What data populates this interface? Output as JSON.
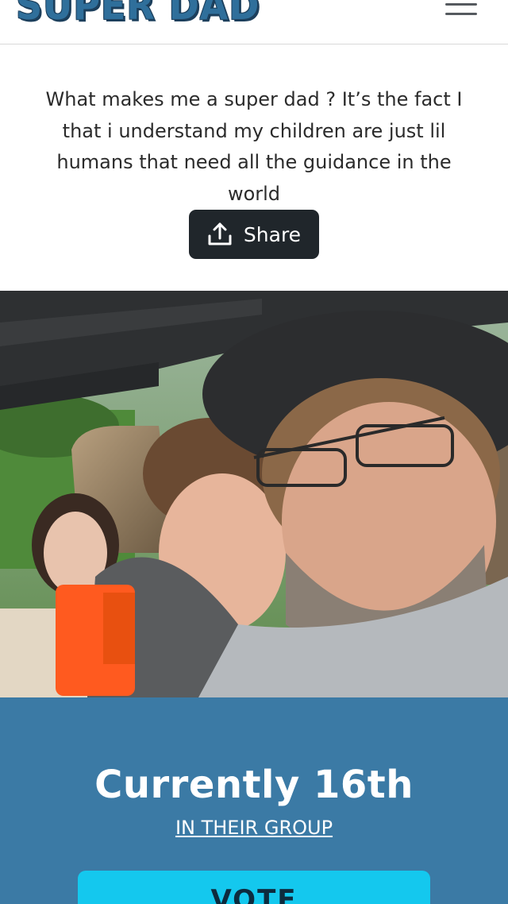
{
  "header": {
    "logo_text": "SUPER DAD",
    "menu_icon": "hamburger-menu-icon"
  },
  "entry": {
    "description": "What makes me a super dad ? It’s the fact I that i understand my children are just lil humans that need all the guidance in the world",
    "share_label": "Share",
    "share_icon": "share-upload-icon",
    "photo_alt": "Selfie of a man with glasses and a cap with a smiling boy and a girl in a jeep"
  },
  "ranking": {
    "title": "Currently 16th",
    "group_link": "IN THEIR GROUP",
    "vote_label": "VOTE"
  },
  "colors": {
    "brand_blue": "#3b7aa5",
    "logo_blue": "#2f6f9b",
    "share_bg": "#20262b",
    "vote_bg": "#14c8ee"
  }
}
